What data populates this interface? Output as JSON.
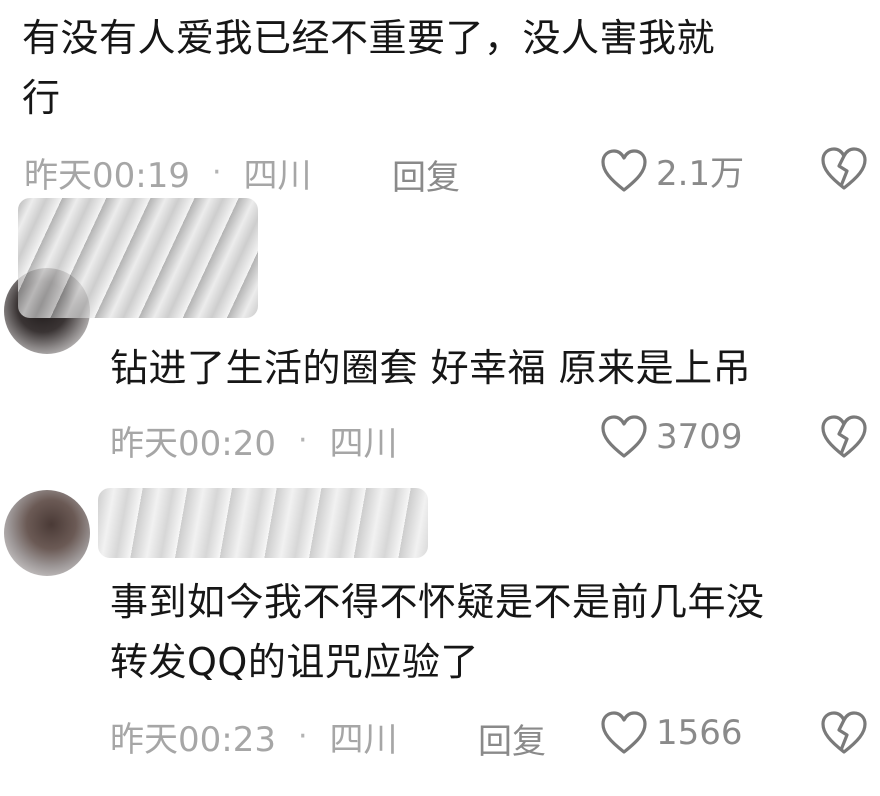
{
  "comments": [
    {
      "text": "有没有人爱我已经不重要了，没人害我就\n行",
      "time": "昨天00:19",
      "dot": "·",
      "location": "四川",
      "reply": "回复",
      "likes": "2.1万"
    },
    {
      "text": "钻进了生活的圈套 好幸福 原来是上吊",
      "time": "昨天00:20",
      "dot": "·",
      "location": "四川",
      "likes": "3709"
    },
    {
      "text": "事到如今我不得不怀疑是不是前几年没\n转发QQ的诅咒应验了",
      "time": "昨天00:23",
      "dot": "·",
      "location": "四川",
      "reply": "回复",
      "likes": "1566"
    }
  ],
  "icons": {
    "like": "heart-outline-icon",
    "dislike": "broken-heart-icon"
  },
  "colors": {
    "text": "#161616",
    "meta": "#a6a6a6",
    "icon": "#7a7a7a"
  }
}
